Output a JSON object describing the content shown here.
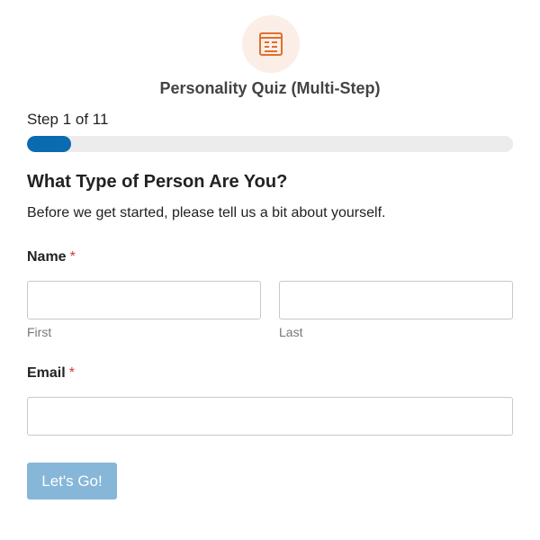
{
  "form": {
    "title": "Personality Quiz (Multi-Step)",
    "header_icon": "form-list-icon"
  },
  "progress": {
    "label": "Step 1 of 11",
    "current_step": 1,
    "total_steps": 11,
    "fill_fraction": 0.09
  },
  "section": {
    "heading": "What Type of Person Are You?",
    "description": "Before we get started, please tell us a bit about yourself."
  },
  "fields": {
    "name": {
      "label": "Name",
      "required_mark": "*",
      "first": {
        "value": "",
        "sublabel": "First"
      },
      "last": {
        "value": "",
        "sublabel": "Last"
      }
    },
    "email": {
      "label": "Email",
      "required_mark": "*",
      "value": ""
    }
  },
  "submit": {
    "label": "Let's Go!"
  },
  "colors": {
    "accent": "#0a6bb0",
    "icon": "#e06f2c",
    "icon_bg": "#fbeee6",
    "required": "#d63637",
    "button_disabled": "#86b6d8"
  }
}
